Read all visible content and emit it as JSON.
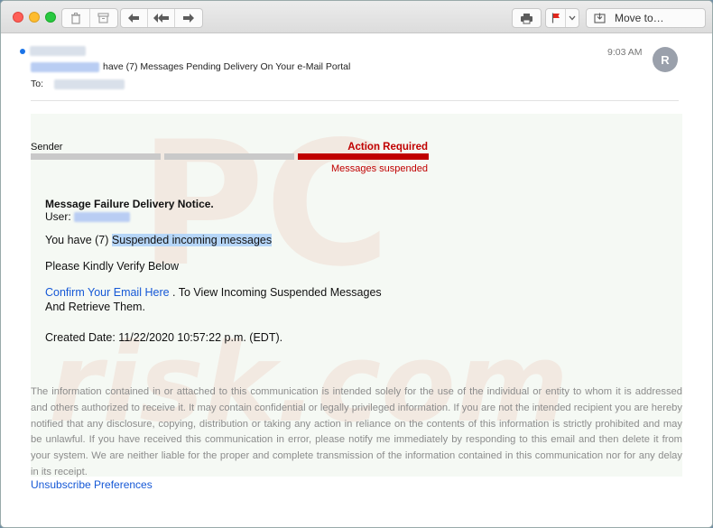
{
  "toolbar": {
    "move_label": "Move to…"
  },
  "email": {
    "time": "9:03 AM",
    "avatar_initial": "R",
    "subject_text": "have (7) Messages Pending Delivery On Your e-Mail Portal",
    "to_label": "To:"
  },
  "banner": {
    "sender_label": "Sender",
    "action_required": "Action Required",
    "messages_suspended": "Messages suspended"
  },
  "message": {
    "title": "Message Failure Delivery Notice.",
    "user_label": "User:",
    "line1_prefix": "You have (7) ",
    "line1_highlight": "Suspended incoming messages",
    "line2": "Please Kindly Verify Below",
    "confirm_link": "Confirm Your Email Here",
    "line3_rest": " . To View Incoming Suspended Messages",
    "line3_cont": "And Retrieve Them.",
    "created_date": "Created Date: 11/22/2020 10:57:22 p.m. (EDT)."
  },
  "footer": {
    "disclaimer": "The information contained in or attached to this communication is intended solely for the use of the individual or entity to whom it is addressed and others authorized to receive it.  It may contain confidential or legally privileged information. If you are not the intended recipient you are hereby notified that any disclosure, copying, distribution or taking any action in reliance on the contents of this information is strictly prohibited and may be unlawful.  If you have received this communication in error, please notify me immediately by responding to this email and then delete it from your system. We are neither liable for the proper and complete transmission of the information contained in this communication nor for any delay in its receipt.",
    "unsubscribe": "Unsubscribe Preferences"
  },
  "watermark": {
    "text_top": "PC",
    "text_bottom": "risk.com"
  },
  "colors": {
    "alert_red": "#c00000",
    "link_blue": "#1558d6",
    "highlight": "#b6d6f8"
  }
}
